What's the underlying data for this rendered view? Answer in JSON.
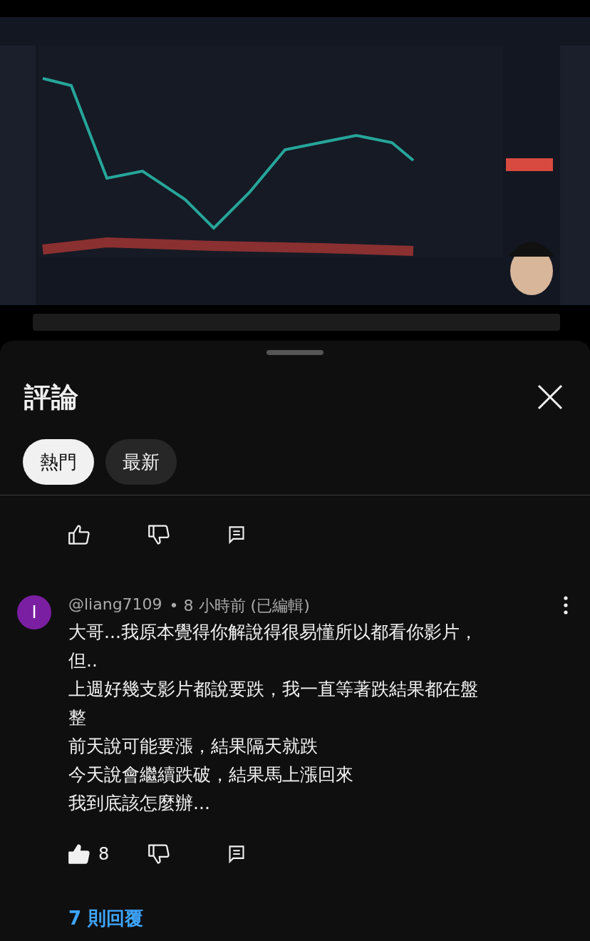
{
  "comments_panel": {
    "title": "評論",
    "filters": [
      {
        "label": "熱門",
        "selected": true
      },
      {
        "label": "最新",
        "selected": false
      }
    ],
    "comments": [
      {
        "kind": "actions",
        "liked": false
      },
      {
        "kind": "comment",
        "avatar_letter": "I",
        "color": "#7b1fa2",
        "author": "@liang7109",
        "meta": "• 8 小時前 (已編輯)",
        "lines": [
          "大哥...我原本覺得你解說得很易懂所以都看你影片，但..",
          "上週好幾支影片都說要跌，我一直等著跌結果都在盤整",
          "前天說可能要漲，結果隔天就跌",
          "今天說會繼續跌破，結果馬上漲回來",
          "我到底該怎麼辦..."
        ],
        "liked": true,
        "likes": "8",
        "replies": "7 則回覆"
      }
    ]
  }
}
